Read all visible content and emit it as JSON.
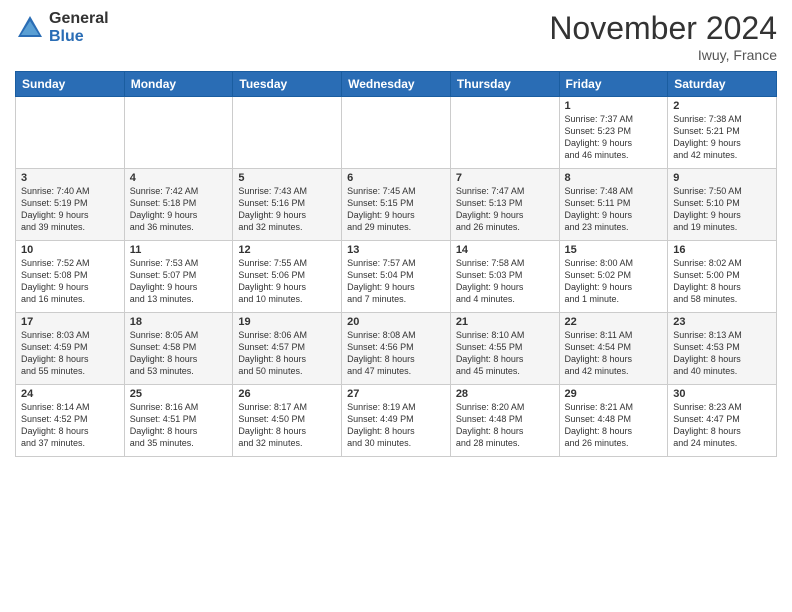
{
  "logo": {
    "general": "General",
    "blue": "Blue"
  },
  "title": "November 2024",
  "location": "Iwuy, France",
  "days_header": [
    "Sunday",
    "Monday",
    "Tuesday",
    "Wednesday",
    "Thursday",
    "Friday",
    "Saturday"
  ],
  "weeks": [
    [
      {
        "day": "",
        "info": ""
      },
      {
        "day": "",
        "info": ""
      },
      {
        "day": "",
        "info": ""
      },
      {
        "day": "",
        "info": ""
      },
      {
        "day": "",
        "info": ""
      },
      {
        "day": "1",
        "info": "Sunrise: 7:37 AM\nSunset: 5:23 PM\nDaylight: 9 hours\nand 46 minutes."
      },
      {
        "day": "2",
        "info": "Sunrise: 7:38 AM\nSunset: 5:21 PM\nDaylight: 9 hours\nand 42 minutes."
      }
    ],
    [
      {
        "day": "3",
        "info": "Sunrise: 7:40 AM\nSunset: 5:19 PM\nDaylight: 9 hours\nand 39 minutes."
      },
      {
        "day": "4",
        "info": "Sunrise: 7:42 AM\nSunset: 5:18 PM\nDaylight: 9 hours\nand 36 minutes."
      },
      {
        "day": "5",
        "info": "Sunrise: 7:43 AM\nSunset: 5:16 PM\nDaylight: 9 hours\nand 32 minutes."
      },
      {
        "day": "6",
        "info": "Sunrise: 7:45 AM\nSunset: 5:15 PM\nDaylight: 9 hours\nand 29 minutes."
      },
      {
        "day": "7",
        "info": "Sunrise: 7:47 AM\nSunset: 5:13 PM\nDaylight: 9 hours\nand 26 minutes."
      },
      {
        "day": "8",
        "info": "Sunrise: 7:48 AM\nSunset: 5:11 PM\nDaylight: 9 hours\nand 23 minutes."
      },
      {
        "day": "9",
        "info": "Sunrise: 7:50 AM\nSunset: 5:10 PM\nDaylight: 9 hours\nand 19 minutes."
      }
    ],
    [
      {
        "day": "10",
        "info": "Sunrise: 7:52 AM\nSunset: 5:08 PM\nDaylight: 9 hours\nand 16 minutes."
      },
      {
        "day": "11",
        "info": "Sunrise: 7:53 AM\nSunset: 5:07 PM\nDaylight: 9 hours\nand 13 minutes."
      },
      {
        "day": "12",
        "info": "Sunrise: 7:55 AM\nSunset: 5:06 PM\nDaylight: 9 hours\nand 10 minutes."
      },
      {
        "day": "13",
        "info": "Sunrise: 7:57 AM\nSunset: 5:04 PM\nDaylight: 9 hours\nand 7 minutes."
      },
      {
        "day": "14",
        "info": "Sunrise: 7:58 AM\nSunset: 5:03 PM\nDaylight: 9 hours\nand 4 minutes."
      },
      {
        "day": "15",
        "info": "Sunrise: 8:00 AM\nSunset: 5:02 PM\nDaylight: 9 hours\nand 1 minute."
      },
      {
        "day": "16",
        "info": "Sunrise: 8:02 AM\nSunset: 5:00 PM\nDaylight: 8 hours\nand 58 minutes."
      }
    ],
    [
      {
        "day": "17",
        "info": "Sunrise: 8:03 AM\nSunset: 4:59 PM\nDaylight: 8 hours\nand 55 minutes."
      },
      {
        "day": "18",
        "info": "Sunrise: 8:05 AM\nSunset: 4:58 PM\nDaylight: 8 hours\nand 53 minutes."
      },
      {
        "day": "19",
        "info": "Sunrise: 8:06 AM\nSunset: 4:57 PM\nDaylight: 8 hours\nand 50 minutes."
      },
      {
        "day": "20",
        "info": "Sunrise: 8:08 AM\nSunset: 4:56 PM\nDaylight: 8 hours\nand 47 minutes."
      },
      {
        "day": "21",
        "info": "Sunrise: 8:10 AM\nSunset: 4:55 PM\nDaylight: 8 hours\nand 45 minutes."
      },
      {
        "day": "22",
        "info": "Sunrise: 8:11 AM\nSunset: 4:54 PM\nDaylight: 8 hours\nand 42 minutes."
      },
      {
        "day": "23",
        "info": "Sunrise: 8:13 AM\nSunset: 4:53 PM\nDaylight: 8 hours\nand 40 minutes."
      }
    ],
    [
      {
        "day": "24",
        "info": "Sunrise: 8:14 AM\nSunset: 4:52 PM\nDaylight: 8 hours\nand 37 minutes."
      },
      {
        "day": "25",
        "info": "Sunrise: 8:16 AM\nSunset: 4:51 PM\nDaylight: 8 hours\nand 35 minutes."
      },
      {
        "day": "26",
        "info": "Sunrise: 8:17 AM\nSunset: 4:50 PM\nDaylight: 8 hours\nand 32 minutes."
      },
      {
        "day": "27",
        "info": "Sunrise: 8:19 AM\nSunset: 4:49 PM\nDaylight: 8 hours\nand 30 minutes."
      },
      {
        "day": "28",
        "info": "Sunrise: 8:20 AM\nSunset: 4:48 PM\nDaylight: 8 hours\nand 28 minutes."
      },
      {
        "day": "29",
        "info": "Sunrise: 8:21 AM\nSunset: 4:48 PM\nDaylight: 8 hours\nand 26 minutes."
      },
      {
        "day": "30",
        "info": "Sunrise: 8:23 AM\nSunset: 4:47 PM\nDaylight: 8 hours\nand 24 minutes."
      }
    ]
  ]
}
